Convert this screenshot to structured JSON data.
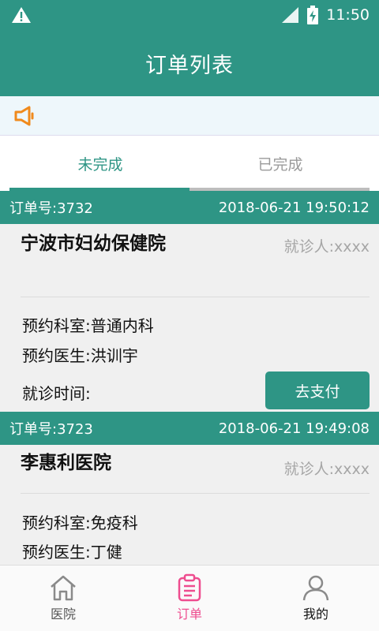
{
  "status_bar": {
    "time": "11:50",
    "icons": [
      "warning-icon",
      "signal-icon",
      "battery-charging-icon"
    ]
  },
  "app_bar": {
    "title": "订单列表"
  },
  "notice": {
    "icon": "speaker-icon"
  },
  "tabs": [
    {
      "label": "未完成",
      "active": true
    },
    {
      "label": "已完成",
      "active": false
    }
  ],
  "orders": [
    {
      "order_no": "订单号:3732",
      "datetime": "2018-06-21 19:50:12",
      "hospital": "宁波市妇幼保健院",
      "patient": "就诊人:xxxx",
      "department": "预约科室:普通内科",
      "doctor": "预约医生:洪训宇",
      "visit_time": "就诊时间:",
      "action": "去支付"
    },
    {
      "order_no": "订单号:3723",
      "datetime": "2018-06-21 19:49:08",
      "hospital": "李惠利医院",
      "patient": "就诊人:xxxx",
      "department": "预约科室:免疫科",
      "doctor": "预约医生:丁健"
    }
  ],
  "bottom_nav": [
    {
      "label": "医院",
      "icon": "home-icon",
      "active": false
    },
    {
      "label": "订单",
      "icon": "clipboard-icon",
      "active": true
    },
    {
      "label": "我的",
      "icon": "user-icon",
      "active": false
    }
  ],
  "colors": {
    "primary": "#2e9585",
    "active_nav": "#ee4d8f",
    "inactive": "#9a9a9a",
    "speaker": "#f08a1c"
  }
}
